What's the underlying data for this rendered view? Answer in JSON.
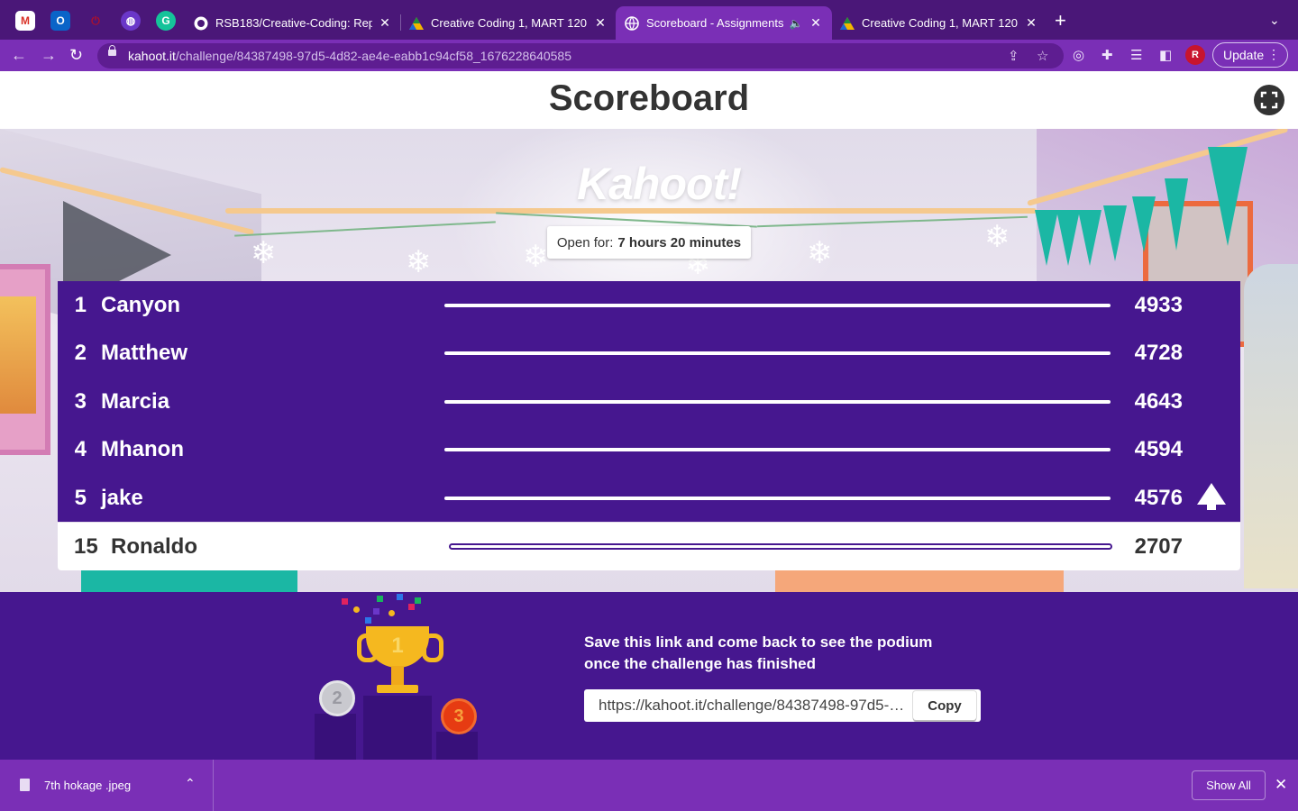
{
  "browser": {
    "pinned_tabs": [
      {
        "icon": "gmail-icon",
        "label": "M",
        "color": "#d93025"
      },
      {
        "icon": "outlook-icon",
        "label": "O",
        "color": "#0a64c8"
      },
      {
        "icon": "power-icon",
        "label": "⏻",
        "color": "#b0102a"
      },
      {
        "icon": "chat-icon",
        "label": "◍",
        "color": "#6a37c9"
      },
      {
        "icon": "grammarly-icon",
        "label": "G",
        "color": "#15c39a"
      }
    ],
    "tabs": [
      {
        "title": "RSB183/Creative-Coding: Repo",
        "icon": "github-icon",
        "active": false
      },
      {
        "title": "Creative Coding 1, MART 120 |",
        "icon": "drive-icon",
        "active": false
      },
      {
        "title": "Scoreboard - Assignments",
        "icon": "globe-icon",
        "active": true
      },
      {
        "title": "Creative Coding 1, MART 120 |",
        "icon": "drive-icon",
        "active": false
      }
    ],
    "url_host": "kahoot.it",
    "url_path": "/challenge/84387498-97d5-4d82-ae4e-eabb1c94cf58_1676228640585",
    "profile_initial": "R",
    "update_label": "Update"
  },
  "page": {
    "title": "Scoreboard",
    "logo_text": "Kahoot!",
    "open_for_label": "Open for:",
    "open_for_value": "7 hours 20 minutes"
  },
  "leaderboard": [
    {
      "rank": "1",
      "name": "Canyon",
      "score": "4933"
    },
    {
      "rank": "2",
      "name": "Matthew",
      "score": "4728"
    },
    {
      "rank": "3",
      "name": "Marcia",
      "score": "4643"
    },
    {
      "rank": "4",
      "name": "Mhanon",
      "score": "4594"
    },
    {
      "rank": "5",
      "name": "jake",
      "score": "4576"
    }
  ],
  "current_player": {
    "rank": "15",
    "name": "Ronaldo",
    "score": "2707"
  },
  "footer": {
    "message": "Save this link and come back to see the podium once the challenge has finished",
    "link_value": "https://kahoot.it/challenge/84387498-97d5-4d82-ae4e-eabb1c94cf58_1676228640585",
    "copy_label": "Copy",
    "medal_1": "1",
    "medal_2": "2",
    "medal_3": "3"
  },
  "downloads": {
    "file_name": "7th hokage .jpeg",
    "show_all_label": "Show All"
  },
  "colors": {
    "kahoot_purple": "#46178f",
    "chrome_purple": "#7a2fb6",
    "tab_strip": "#4a1778"
  }
}
